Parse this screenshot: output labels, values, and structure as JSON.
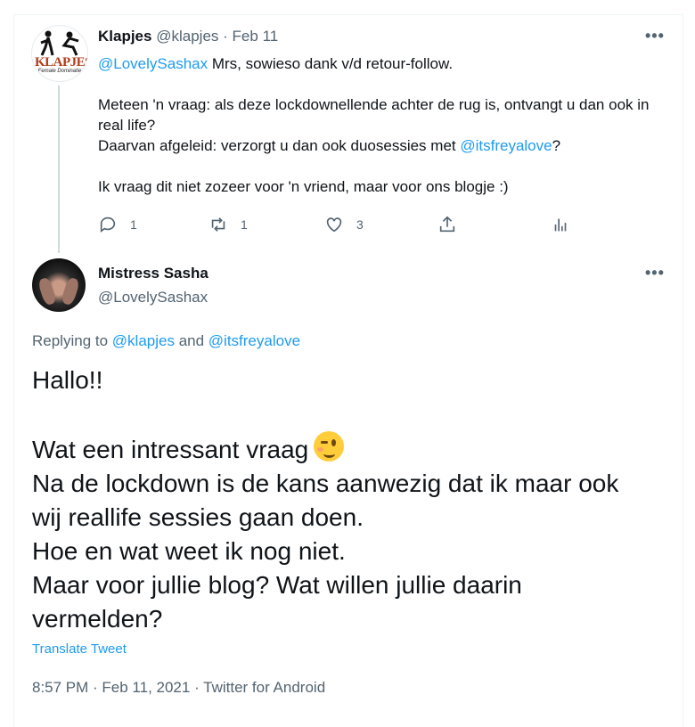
{
  "tweet1": {
    "name": "Klapjes",
    "handle": "@klapjes",
    "date": "Feb 11",
    "avatar_text": "KLAPJES",
    "avatar_sub": "Female Dominatie",
    "mention": "@LovelySashax",
    "line1_rest": " Mrs, sowieso dank v/d retour-follow.",
    "line2": "Meteen 'n vraag: als deze lockdownellende achter de rug is, ontvangt u dan ook in real life?",
    "line3_pre": "Daarvan afgeleid: verzorgt u dan ook duosessies met ",
    "line3_mention": "@itsfreyalove",
    "line3_post": "?",
    "line4": "Ik vraag dit niet zozeer voor 'n vriend, maar voor ons blogje :)",
    "reply_count": "1",
    "retweet_count": "1",
    "like_count": "3"
  },
  "tweet2": {
    "name": "Mistress Sasha",
    "handle": "@LovelySashax",
    "replying_pre": "Replying to ",
    "replying_user1": "@klapjes",
    "replying_and": " and ",
    "replying_user2": "@itsfreyalove",
    "lines": [
      "Hallo!!",
      "Wat een intressant vraag",
      "Na de lockdown is de kans aanwezig dat ik maar ook",
      "wij reallife sessies gaan doen.",
      "Hoe en wat weet ik nog niet.",
      "Maar voor jullie blog? Wat willen jullie daarin",
      "vermelden?"
    ],
    "translate": "Translate Tweet",
    "meta": "8:57 PM · Feb 11, 2021 · Twitter for Android"
  },
  "more_glyph": "•••"
}
